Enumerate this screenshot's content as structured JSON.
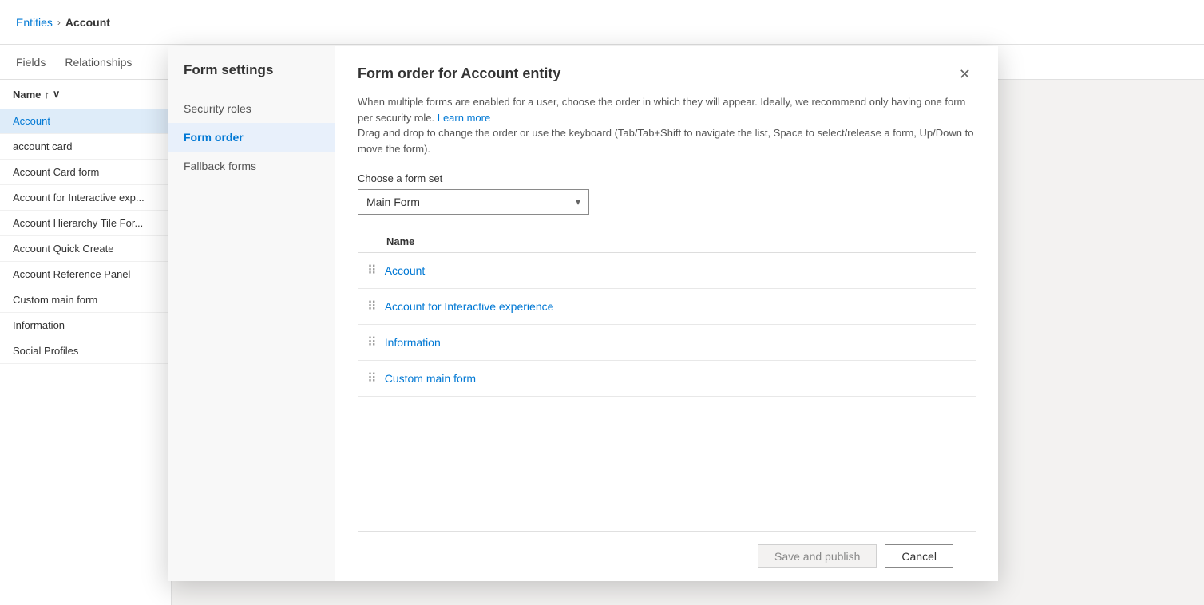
{
  "page": {
    "breadcrumb": {
      "link_label": "Entities",
      "separator": "›",
      "current": "Account"
    },
    "nav_links": [
      "Fields",
      "Relationships"
    ],
    "name_header": {
      "label": "Name",
      "sort_asc": "↑",
      "sort_toggle": "∨"
    },
    "sidebar_items": [
      {
        "label": "Account",
        "active": false
      },
      {
        "label": "account card",
        "active": false
      },
      {
        "label": "Account Card form",
        "active": false
      },
      {
        "label": "Account for Interactive exp...",
        "active": false
      },
      {
        "label": "Account Hierarchy Tile For...",
        "active": false
      },
      {
        "label": "Account Quick Create",
        "active": false
      },
      {
        "label": "Account Reference Panel",
        "active": false
      },
      {
        "label": "Custom main form",
        "active": false
      },
      {
        "label": "Information",
        "active": false
      },
      {
        "label": "Social Profiles",
        "active": false
      }
    ]
  },
  "modal": {
    "left_title": "Form settings",
    "nav_items": [
      {
        "label": "Security roles",
        "active": false
      },
      {
        "label": "Form order",
        "active": true
      },
      {
        "label": "Fallback forms",
        "active": false
      }
    ],
    "right": {
      "title": "Form order for Account entity",
      "description_part1": "When multiple forms are enabled for a user, choose the order in which they will appear. Ideally, we recommend only having one form per security role.",
      "learn_more_label": "Learn more",
      "description_part2": "Drag and drop to change the order or use the keyboard (Tab/Tab+Shift to navigate the list, Space to select/release a form, Up/Down to move the form).",
      "form_set_label": "Choose a form set",
      "form_set_value": "Main Form",
      "table_header": "Name",
      "form_rows": [
        {
          "label": "Account"
        },
        {
          "label": "Account for Interactive experience"
        },
        {
          "label": "Information"
        },
        {
          "label": "Custom main form"
        }
      ]
    },
    "footer": {
      "save_label": "Save and publish",
      "cancel_label": "Cancel"
    }
  }
}
